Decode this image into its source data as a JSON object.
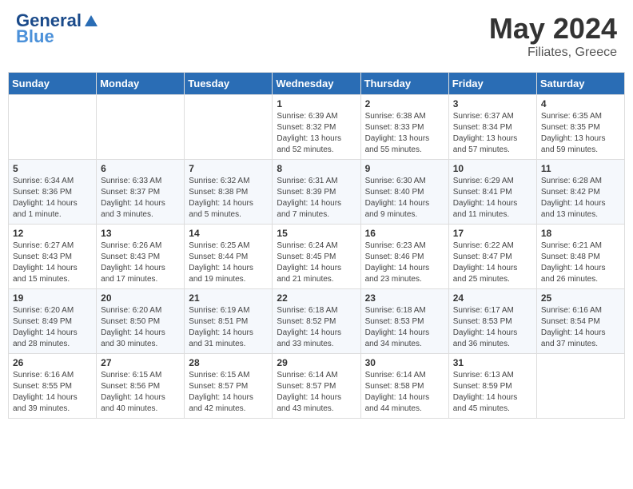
{
  "header": {
    "logo_line1": "General",
    "logo_line2": "Blue",
    "month": "May 2024",
    "location": "Filiates, Greece"
  },
  "weekdays": [
    "Sunday",
    "Monday",
    "Tuesday",
    "Wednesday",
    "Thursday",
    "Friday",
    "Saturday"
  ],
  "weeks": [
    [
      {
        "day": "",
        "info": ""
      },
      {
        "day": "",
        "info": ""
      },
      {
        "day": "",
        "info": ""
      },
      {
        "day": "1",
        "info": "Sunrise: 6:39 AM\nSunset: 8:32 PM\nDaylight: 13 hours\nand 52 minutes."
      },
      {
        "day": "2",
        "info": "Sunrise: 6:38 AM\nSunset: 8:33 PM\nDaylight: 13 hours\nand 55 minutes."
      },
      {
        "day": "3",
        "info": "Sunrise: 6:37 AM\nSunset: 8:34 PM\nDaylight: 13 hours\nand 57 minutes."
      },
      {
        "day": "4",
        "info": "Sunrise: 6:35 AM\nSunset: 8:35 PM\nDaylight: 13 hours\nand 59 minutes."
      }
    ],
    [
      {
        "day": "5",
        "info": "Sunrise: 6:34 AM\nSunset: 8:36 PM\nDaylight: 14 hours\nand 1 minute."
      },
      {
        "day": "6",
        "info": "Sunrise: 6:33 AM\nSunset: 8:37 PM\nDaylight: 14 hours\nand 3 minutes."
      },
      {
        "day": "7",
        "info": "Sunrise: 6:32 AM\nSunset: 8:38 PM\nDaylight: 14 hours\nand 5 minutes."
      },
      {
        "day": "8",
        "info": "Sunrise: 6:31 AM\nSunset: 8:39 PM\nDaylight: 14 hours\nand 7 minutes."
      },
      {
        "day": "9",
        "info": "Sunrise: 6:30 AM\nSunset: 8:40 PM\nDaylight: 14 hours\nand 9 minutes."
      },
      {
        "day": "10",
        "info": "Sunrise: 6:29 AM\nSunset: 8:41 PM\nDaylight: 14 hours\nand 11 minutes."
      },
      {
        "day": "11",
        "info": "Sunrise: 6:28 AM\nSunset: 8:42 PM\nDaylight: 14 hours\nand 13 minutes."
      }
    ],
    [
      {
        "day": "12",
        "info": "Sunrise: 6:27 AM\nSunset: 8:43 PM\nDaylight: 14 hours\nand 15 minutes."
      },
      {
        "day": "13",
        "info": "Sunrise: 6:26 AM\nSunset: 8:43 PM\nDaylight: 14 hours\nand 17 minutes."
      },
      {
        "day": "14",
        "info": "Sunrise: 6:25 AM\nSunset: 8:44 PM\nDaylight: 14 hours\nand 19 minutes."
      },
      {
        "day": "15",
        "info": "Sunrise: 6:24 AM\nSunset: 8:45 PM\nDaylight: 14 hours\nand 21 minutes."
      },
      {
        "day": "16",
        "info": "Sunrise: 6:23 AM\nSunset: 8:46 PM\nDaylight: 14 hours\nand 23 minutes."
      },
      {
        "day": "17",
        "info": "Sunrise: 6:22 AM\nSunset: 8:47 PM\nDaylight: 14 hours\nand 25 minutes."
      },
      {
        "day": "18",
        "info": "Sunrise: 6:21 AM\nSunset: 8:48 PM\nDaylight: 14 hours\nand 26 minutes."
      }
    ],
    [
      {
        "day": "19",
        "info": "Sunrise: 6:20 AM\nSunset: 8:49 PM\nDaylight: 14 hours\nand 28 minutes."
      },
      {
        "day": "20",
        "info": "Sunrise: 6:20 AM\nSunset: 8:50 PM\nDaylight: 14 hours\nand 30 minutes."
      },
      {
        "day": "21",
        "info": "Sunrise: 6:19 AM\nSunset: 8:51 PM\nDaylight: 14 hours\nand 31 minutes."
      },
      {
        "day": "22",
        "info": "Sunrise: 6:18 AM\nSunset: 8:52 PM\nDaylight: 14 hours\nand 33 minutes."
      },
      {
        "day": "23",
        "info": "Sunrise: 6:18 AM\nSunset: 8:53 PM\nDaylight: 14 hours\nand 34 minutes."
      },
      {
        "day": "24",
        "info": "Sunrise: 6:17 AM\nSunset: 8:53 PM\nDaylight: 14 hours\nand 36 minutes."
      },
      {
        "day": "25",
        "info": "Sunrise: 6:16 AM\nSunset: 8:54 PM\nDaylight: 14 hours\nand 37 minutes."
      }
    ],
    [
      {
        "day": "26",
        "info": "Sunrise: 6:16 AM\nSunset: 8:55 PM\nDaylight: 14 hours\nand 39 minutes."
      },
      {
        "day": "27",
        "info": "Sunrise: 6:15 AM\nSunset: 8:56 PM\nDaylight: 14 hours\nand 40 minutes."
      },
      {
        "day": "28",
        "info": "Sunrise: 6:15 AM\nSunset: 8:57 PM\nDaylight: 14 hours\nand 42 minutes."
      },
      {
        "day": "29",
        "info": "Sunrise: 6:14 AM\nSunset: 8:57 PM\nDaylight: 14 hours\nand 43 minutes."
      },
      {
        "day": "30",
        "info": "Sunrise: 6:14 AM\nSunset: 8:58 PM\nDaylight: 14 hours\nand 44 minutes."
      },
      {
        "day": "31",
        "info": "Sunrise: 6:13 AM\nSunset: 8:59 PM\nDaylight: 14 hours\nand 45 minutes."
      },
      {
        "day": "",
        "info": ""
      }
    ]
  ]
}
